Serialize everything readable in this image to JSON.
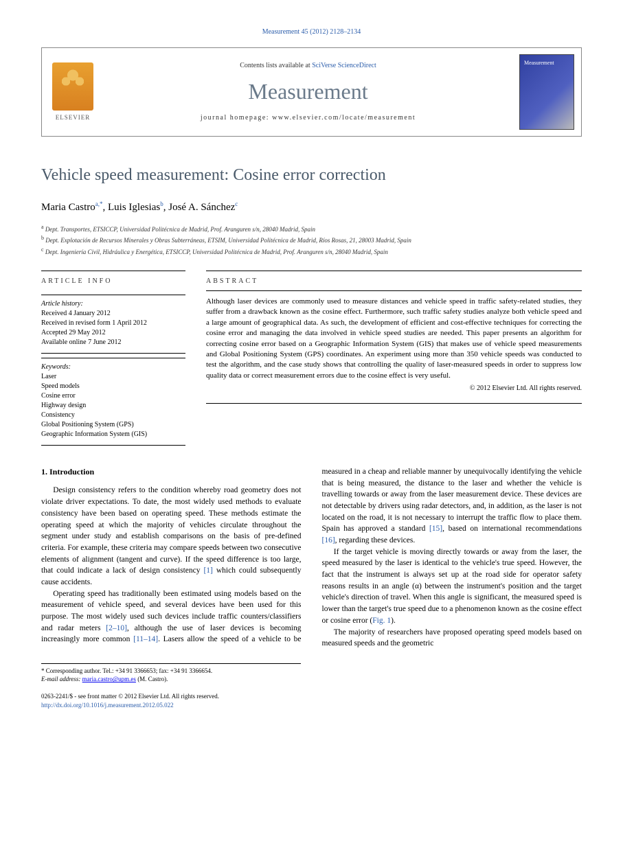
{
  "header": {
    "citation": "Measurement 45 (2012) 2128–2134",
    "contents_prefix": "Contents lists available at ",
    "contents_link": "SciVerse ScienceDirect",
    "journal_name": "Measurement",
    "homepage_label": "journal homepage: ",
    "homepage_url": "www.elsevier.com/locate/measurement",
    "publisher": "ELSEVIER",
    "cover_text": "Measurement"
  },
  "article": {
    "title": "Vehicle speed measurement: Cosine error correction",
    "authors_html": "Maria Castro",
    "author1": "Maria Castro",
    "author1_sup": "a,*",
    "author2": "Luis Iglesias",
    "author2_sup": "b",
    "author3": "José A. Sánchez",
    "author3_sup": "c",
    "affiliations": {
      "a": "Dept. Transportes, ETSICCP, Universidad Politécnica de Madrid, Prof. Aranguren s/n, 28040 Madrid, Spain",
      "b": "Dept. Explotación de Recursos Minerales y Obras Subterráneas, ETSIM, Universidad Politécnica de Madrid, Ríos Rosas, 21, 28003 Madrid, Spain",
      "c": "Dept. Ingeniería Civil, Hidráulica y Energética, ETSICCP, Universidad Politécnica de Madrid, Prof. Aranguren s/n, 28040 Madrid, Spain"
    }
  },
  "info": {
    "heading": "ARTICLE INFO",
    "history_label": "Article history:",
    "received": "Received 4 January 2012",
    "revised": "Received in revised form 1 April 2012",
    "accepted": "Accepted 29 May 2012",
    "online": "Available online 7 June 2012",
    "keywords_label": "Keywords:",
    "keywords": [
      "Laser",
      "Speed models",
      "Cosine error",
      "Highway design",
      "Consistency",
      "Global Positioning System (GPS)",
      "Geographic Information System (GIS)"
    ]
  },
  "abstract": {
    "heading": "ABSTRACT",
    "text": "Although laser devices are commonly used to measure distances and vehicle speed in traffic safety-related studies, they suffer from a drawback known as the cosine effect. Furthermore, such traffic safety studies analyze both vehicle speed and a large amount of geographical data. As such, the development of efficient and cost-effective techniques for correcting the cosine error and managing the data involved in vehicle speed studies are needed. This paper presents an algorithm for correcting cosine error based on a Geographic Information System (GIS) that makes use of vehicle speed measurements and Global Positioning System (GPS) coordinates. An experiment using more than 350 vehicle speeds was conducted to test the algorithm, and the case study shows that controlling the quality of laser-measured speeds in order to suppress low quality data or correct measurement errors due to the cosine effect is very useful.",
    "copyright": "© 2012 Elsevier Ltd. All rights reserved."
  },
  "body": {
    "section1_heading": "1. Introduction",
    "p1": "Design consistency refers to the condition whereby road geometry does not violate driver expectations. To date, the most widely used methods to evaluate consistency have been based on operating speed. These methods estimate the operating speed at which the majority of vehicles circulate throughout the segment under study and establish comparisons on the basis of pre-defined criteria. For example, these criteria may compare speeds between two consecutive elements of alignment (tangent and curve). If the speed difference is too large, that could indicate a lack of design consistency ",
    "p1_ref": "[1]",
    "p1_tail": " which could subsequently cause accidents.",
    "p2": "Operating speed has traditionally been estimated using models based on the measurement of vehicle speed, and several devices have been used for this purpose. The most widely used such devices include traffic counters/classifiers and radar meters ",
    "p2_ref": "[2–10]",
    "p2_mid": ", although the use of laser de",
    "p2b": "vices is becoming increasingly more common ",
    "p2b_ref": "[11–14]",
    "p2b_tail": ". Lasers allow the speed of a vehicle to be measured in a cheap and reliable manner by unequivocally identifying the vehicle that is being measured, the distance to the laser and whether the vehicle is travelling towards or away from the laser measurement device. These devices are not detectable by drivers using radar detectors, and, in addition, as the laser is not located on the road, it is not necessary to interrupt the traffic flow to place them. Spain has approved a standard ",
    "p2c_ref": "[15]",
    "p2c_mid": ", based on international recommendations ",
    "p2d_ref": "[16]",
    "p2d_tail": ", regarding these devices.",
    "p3": "If the target vehicle is moving directly towards or away from the laser, the speed measured by the laser is identical to the vehicle's true speed. However, the fact that the instrument is always set up at the road side for operator safety reasons results in an angle (α) between the instrument's position and the target vehicle's direction of travel. When this angle is significant, the measured speed is lower than the target's true speed due to a phenomenon known as the cosine effect or cosine error (",
    "p3_ref": "Fig. 1",
    "p3_tail": ").",
    "p4": "The majority of researchers have proposed operating speed models based on measured speeds and the geometric"
  },
  "footnote": {
    "corresponding": "* Corresponding author. Tel.: +34 91 3366653; fax: +34 91 3366654.",
    "email_label": "E-mail address: ",
    "email": "maria.castro@upm.es",
    "email_tail": " (M. Castro)."
  },
  "footer": {
    "issn": "0263-2241/$ - see front matter © 2012 Elsevier Ltd. All rights reserved.",
    "doi": "http://dx.doi.org/10.1016/j.measurement.2012.05.022"
  }
}
